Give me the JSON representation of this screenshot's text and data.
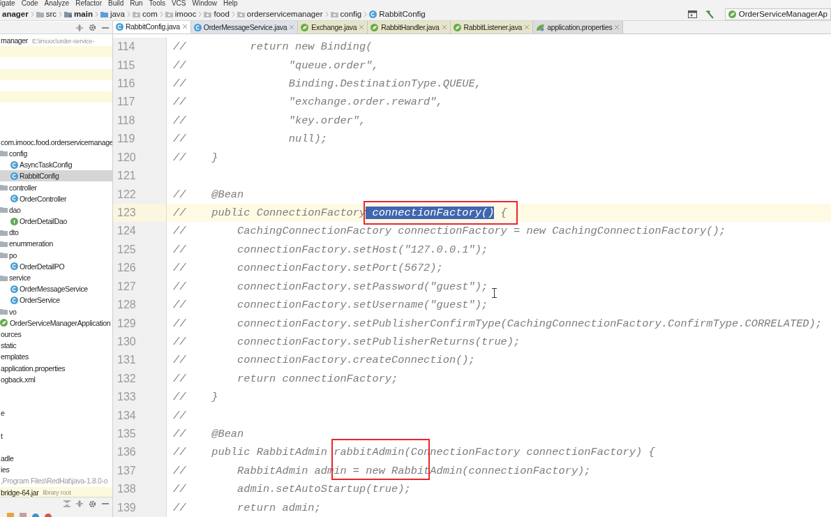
{
  "menu_bar": [
    "igate",
    "Code",
    "Analyze",
    "Refactor",
    "Build",
    "Run",
    "Tools",
    "VCS",
    "Window",
    "Help"
  ],
  "breadcrumbs": [
    {
      "label": "anager",
      "kind": "project"
    },
    {
      "label": "src",
      "kind": "folder"
    },
    {
      "label": "main",
      "kind": "source-set"
    },
    {
      "label": "java",
      "kind": "source-root"
    },
    {
      "label": "com",
      "kind": "package"
    },
    {
      "label": "imooc",
      "kind": "package"
    },
    {
      "label": "food",
      "kind": "package"
    },
    {
      "label": "orderservicemanager",
      "kind": "package"
    },
    {
      "label": "config",
      "kind": "package"
    },
    {
      "label": "RabbitConfig",
      "kind": "class"
    }
  ],
  "run_configuration": "OrderServiceManagerAp",
  "tabs": [
    {
      "label": "RabbitConfig.java",
      "kind": "class",
      "selected": true,
      "color": "#ffffff"
    },
    {
      "label": "OrderMessageService.java",
      "kind": "class",
      "selected": false,
      "color": "#dde2ea"
    },
    {
      "label": "Exchange.java",
      "kind": "spring",
      "selected": false,
      "color": "#e7e5c9"
    },
    {
      "label": "RabbitHandler.java",
      "kind": "spring",
      "selected": false,
      "color": "#e7e5c9"
    },
    {
      "label": "RabbitListener.java",
      "kind": "spring",
      "selected": false,
      "color": "#e7e5c9"
    },
    {
      "label": "application.properties",
      "kind": "properties",
      "selected": false,
      "color": "#dcdcdc"
    }
  ],
  "project_tree": [
    {
      "label": "manager",
      "hint": "E:\\imooc\\order-service-",
      "kind": "text",
      "selected": false,
      "highlighted": false
    },
    {
      "kind": "blank",
      "selected": false,
      "highlighted": true
    },
    {
      "kind": "blank",
      "selected": false,
      "highlighted": false
    },
    {
      "kind": "blank",
      "selected": false,
      "highlighted": true
    },
    {
      "kind": "blank",
      "selected": false,
      "highlighted": false
    },
    {
      "kind": "blank",
      "selected": false,
      "highlighted": true
    },
    {
      "kind": "blank",
      "selected": false,
      "highlighted": false
    },
    {
      "kind": "blank",
      "selected": false,
      "highlighted": false
    },
    {
      "kind": "blank",
      "selected": false,
      "highlighted": false
    },
    {
      "label": "com.imooc.food.orderservicemanage",
      "kind": "text",
      "selected": false,
      "highlighted": false,
      "children": [
        {
          "label": "config",
          "kind": "folder",
          "selected": false,
          "highlighted": false,
          "children": [
            {
              "label": "AsyncTaskConfig",
              "kind": "class",
              "selected": false,
              "highlighted": false
            },
            {
              "label": "RabbitConfig",
              "kind": "class",
              "selected": true,
              "highlighted": false
            }
          ]
        },
        {
          "label": "controller",
          "kind": "folder",
          "selected": false,
          "highlighted": false,
          "children": [
            {
              "label": "OrderController",
              "kind": "class",
              "selected": false,
              "highlighted": false
            }
          ]
        },
        {
          "label": "dao",
          "kind": "folder",
          "selected": false,
          "highlighted": false,
          "children": [
            {
              "label": "OrderDetailDao",
              "kind": "interface",
              "selected": false,
              "highlighted": false
            }
          ]
        },
        {
          "label": "dto",
          "kind": "folder",
          "selected": false,
          "highlighted": false
        },
        {
          "label": "enummeration",
          "kind": "folder",
          "selected": false,
          "highlighted": false
        },
        {
          "label": "po",
          "kind": "folder",
          "selected": false,
          "highlighted": false,
          "children": [
            {
              "label": "OrderDetailPO",
              "kind": "class",
              "selected": false,
              "highlighted": false
            }
          ]
        },
        {
          "label": "service",
          "kind": "folder",
          "selected": false,
          "highlighted": false,
          "children": [
            {
              "label": "OrderMessageService",
              "kind": "class",
              "selected": false,
              "highlighted": false
            },
            {
              "label": "OrderService",
              "kind": "class",
              "selected": false,
              "highlighted": false
            }
          ]
        },
        {
          "label": "vo",
          "kind": "folder",
          "selected": false,
          "highlighted": false
        },
        {
          "label": "OrderServiceManagerApplication",
          "kind": "spring",
          "selected": false,
          "highlighted": false
        }
      ]
    },
    {
      "label": "ources",
      "kind": "text",
      "selected": false,
      "highlighted": false
    },
    {
      "label": "static",
      "kind": "text",
      "selected": false,
      "highlighted": false
    },
    {
      "label": "emplates",
      "kind": "text",
      "selected": false,
      "highlighted": false
    },
    {
      "label": "application.properties",
      "kind": "text",
      "selected": false,
      "highlighted": false
    },
    {
      "label": "ogback.xml",
      "kind": "text",
      "selected": false,
      "highlighted": false
    },
    {
      "kind": "blank",
      "selected": false,
      "highlighted": false
    },
    {
      "kind": "blank",
      "selected": false,
      "highlighted": false
    },
    {
      "label": "e",
      "kind": "text",
      "selected": false,
      "highlighted": false
    },
    {
      "kind": "blank",
      "selected": false,
      "highlighted": false
    },
    {
      "label": "t",
      "kind": "text",
      "selected": false,
      "highlighted": false
    },
    {
      "kind": "blank",
      "selected": false,
      "highlighted": false
    },
    {
      "label": "adle",
      "kind": "text",
      "selected": false,
      "highlighted": false
    },
    {
      "label": "ies",
      "kind": "text",
      "selected": false,
      "highlighted": false
    },
    {
      "label": ",Program Files\\RedHat\\java-1.8.0-o",
      "kind": "dim",
      "selected": false,
      "highlighted": false
    },
    {
      "label": "bridge-64.jar",
      "hint": "library root",
      "kind": "text",
      "selected": false,
      "highlighted": true
    }
  ],
  "code_lines": [
    {
      "number": "114",
      "current": false,
      "text": "//          return new Binding("
    },
    {
      "number": "115",
      "current": false,
      "text": "//                \"queue.order\","
    },
    {
      "number": "116",
      "current": false,
      "text": "//                Binding.DestinationType.QUEUE,"
    },
    {
      "number": "117",
      "current": false,
      "text": "//                \"exchange.order.reward\","
    },
    {
      "number": "118",
      "current": false,
      "text": "//                \"key.order\","
    },
    {
      "number": "119",
      "current": false,
      "text": "//                null);"
    },
    {
      "number": "120",
      "current": false,
      "text": "//    }"
    },
    {
      "number": "121",
      "current": false
    },
    {
      "number": "122",
      "current": false,
      "text": "//    @Bean"
    },
    {
      "number": "123",
      "current": true,
      "segments": [
        {
          "text": "//    public ConnectionFactory",
          "selected": false,
          "kind": "plain"
        },
        {
          "text": " connectionFactory()",
          "selected": true,
          "kind": "boxed"
        },
        {
          "text": " {",
          "selected": false,
          "kind": "plain"
        }
      ]
    },
    {
      "number": "124",
      "current": false,
      "text": "//        CachingConnectionFactory connectionFactory = new CachingConnectionFactory();"
    },
    {
      "number": "125",
      "current": false,
      "text": "//        connectionFactory.setHost(\"127.0.0.1\");"
    },
    {
      "number": "126",
      "current": false,
      "text": "//        connectionFactory.setPort(5672);"
    },
    {
      "number": "127",
      "current": false,
      "text": "//        connectionFactory.setPassword(\"guest\");"
    },
    {
      "number": "128",
      "current": false,
      "text": "//        connectionFactory.setUsername(\"guest\");"
    },
    {
      "number": "129",
      "current": false,
      "text": "//        connectionFactory.setPublisherConfirmType(CachingConnectionFactory.ConfirmType.CORRELATED);"
    },
    {
      "number": "130",
      "current": false,
      "text": "//        connectionFactory.setPublisherReturns(true);"
    },
    {
      "number": "131",
      "current": false,
      "text": "//        connectionFactory.createConnection();"
    },
    {
      "number": "132",
      "current": false,
      "text": "//        return connectionFactory;"
    },
    {
      "number": "133",
      "current": false,
      "text": "//    }"
    },
    {
      "number": "134",
      "current": false,
      "text": "//"
    },
    {
      "number": "135",
      "current": false,
      "text": "//    @Bean"
    },
    {
      "number": "136",
      "current": false,
      "segments": [
        {
          "text": "//    public RabbitAdmin ",
          "selected": false,
          "kind": "plain"
        },
        {
          "text": "rabbitAdmin(Co",
          "selected": false,
          "kind": "tall-boxed"
        },
        {
          "text": "nnectionFactory connectionFactory) {",
          "selected": false,
          "kind": "plain"
        }
      ]
    },
    {
      "number": "137",
      "current": false,
      "text": "//        RabbitAdmin admin = new RabbitAdmin(connectionFactory);"
    },
    {
      "number": "138",
      "current": false,
      "text": "//        admin.setAutoStartup(true);"
    },
    {
      "number": "139",
      "current": false,
      "text": "//        return admin;"
    }
  ]
}
